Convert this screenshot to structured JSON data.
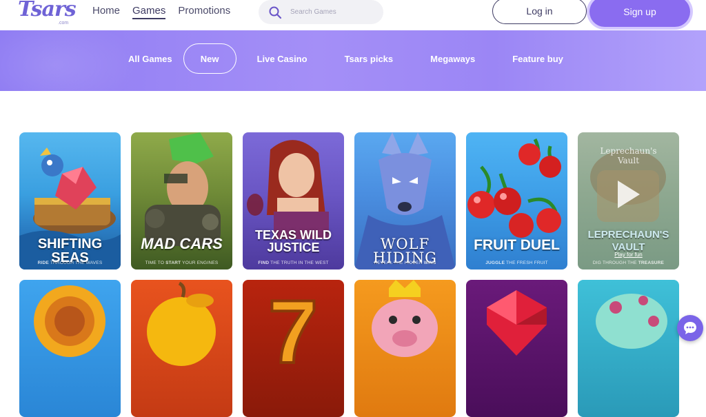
{
  "header": {
    "logo_text": "Tsars",
    "logo_sub": ".com",
    "nav": [
      {
        "label": "Home",
        "active": false
      },
      {
        "label": "Games",
        "active": true
      },
      {
        "label": "Promotions",
        "active": false
      }
    ],
    "search_placeholder": "Search Games",
    "login_label": "Log in",
    "signup_label": "Sign up"
  },
  "categories": [
    {
      "label": "All Games",
      "active": false
    },
    {
      "label": "New",
      "active": true
    },
    {
      "label": "Live Casino",
      "active": false
    },
    {
      "label": "Tsars picks",
      "active": false
    },
    {
      "label": "Megaways",
      "active": false
    },
    {
      "label": "Feature buy",
      "active": false
    }
  ],
  "games_row1": [
    {
      "title": "SHIFTING SEAS",
      "sub_pre": "RIDE",
      "sub_post": " THROUGH THE WAVES"
    },
    {
      "title": "MAD CARS",
      "sub_pre": "TIME TO ",
      "sub_strong": "START",
      "sub_post": " YOUR ENGINES"
    },
    {
      "title_line1": "TEXAS WILD",
      "title_line2": "JUSTICE",
      "sub_pre": "FIND",
      "sub_post": " THE TRUTH IN THE WEST"
    },
    {
      "title": "WOLF HIDING",
      "sub_pre": "REVEAL THE HIDDEN ",
      "sub_strong": "WINS"
    },
    {
      "title": "FRUIT DUEL",
      "sub_pre": "JUGGLE",
      "sub_post": " THE FRESH FRUIT"
    },
    {
      "art_text_line1": "Leprechaun's",
      "art_text_line2": "Vault",
      "title_line1": "LEPRECHAUN'S",
      "title_line2": "VAULT",
      "play_for_fun": "Play for fun",
      "sub_pre": "DIG THROUGH THE ",
      "sub_strong": "TREASURE"
    }
  ],
  "colors": {
    "accent": "#8a6cf0",
    "band_start": "#8f7cf3",
    "nav_text": "#4b4a6a"
  }
}
